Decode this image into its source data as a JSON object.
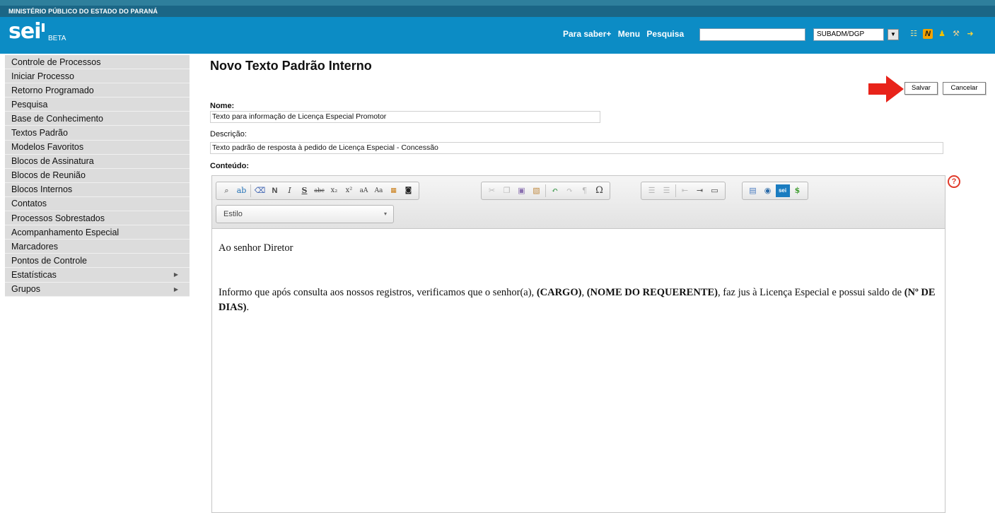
{
  "org": {
    "name": "MINISTÉRIO PÚBLICO DO ESTADO DO PARANÁ"
  },
  "header": {
    "logo": "sei",
    "beta": "BETA",
    "links": [
      "Para saber+",
      "Menu",
      "Pesquisa"
    ],
    "search_value": "",
    "unit": "SUBADM/DGP",
    "icons": [
      "list-icon",
      "notes-icon",
      "user-icon",
      "tools-icon",
      "exit-icon"
    ]
  },
  "sidebar": {
    "items": [
      {
        "label": "Controle de Processos"
      },
      {
        "label": "Iniciar Processo"
      },
      {
        "label": "Retorno Programado"
      },
      {
        "label": "Pesquisa"
      },
      {
        "label": "Base de Conhecimento"
      },
      {
        "label": "Textos Padrão"
      },
      {
        "label": "Modelos Favoritos"
      },
      {
        "label": "Blocos de Assinatura"
      },
      {
        "label": "Blocos de Reunião"
      },
      {
        "label": "Blocos Internos"
      },
      {
        "label": "Contatos"
      },
      {
        "label": "Processos Sobrestados"
      },
      {
        "label": "Acompanhamento Especial"
      },
      {
        "label": "Marcadores"
      },
      {
        "label": "Pontos de Controle"
      },
      {
        "label": "Estatísticas",
        "submenu": true
      },
      {
        "label": "Grupos",
        "submenu": true
      }
    ]
  },
  "main": {
    "title": "Novo Texto Padrão Interno",
    "save_label": "Salvar",
    "cancel_label": "Cancelar",
    "nome_label": "Nome:",
    "nome_value": "Texto para informação de Licença Especial Promotor",
    "descricao_label": "Descrição:",
    "descricao_value": "Texto padrão de resposta à pedido de Licença Especial - Concessão",
    "conteudo_label": "Conteúdo:",
    "style_label": "Estilo",
    "help_icon": "?"
  },
  "editor": {
    "line1": "Ao senhor Diretor",
    "para_pre": "Informo que após consulta aos nossos registros, verificamos que o senhor(a), ",
    "cargo": "(CARGO)",
    "sep1": ", ",
    "nome": "(NOME DO REQUERENTE)",
    "para_mid": ", faz jus à Licença Especial e possui saldo de ",
    "dias": "(Nº DE DIAS)",
    "para_end": "."
  },
  "colors": {
    "header_bg": "#0c8cc5",
    "org_bg": "#1b6686",
    "sidebar_bg": "#dcdcdc",
    "arrow": "#e8231a"
  }
}
